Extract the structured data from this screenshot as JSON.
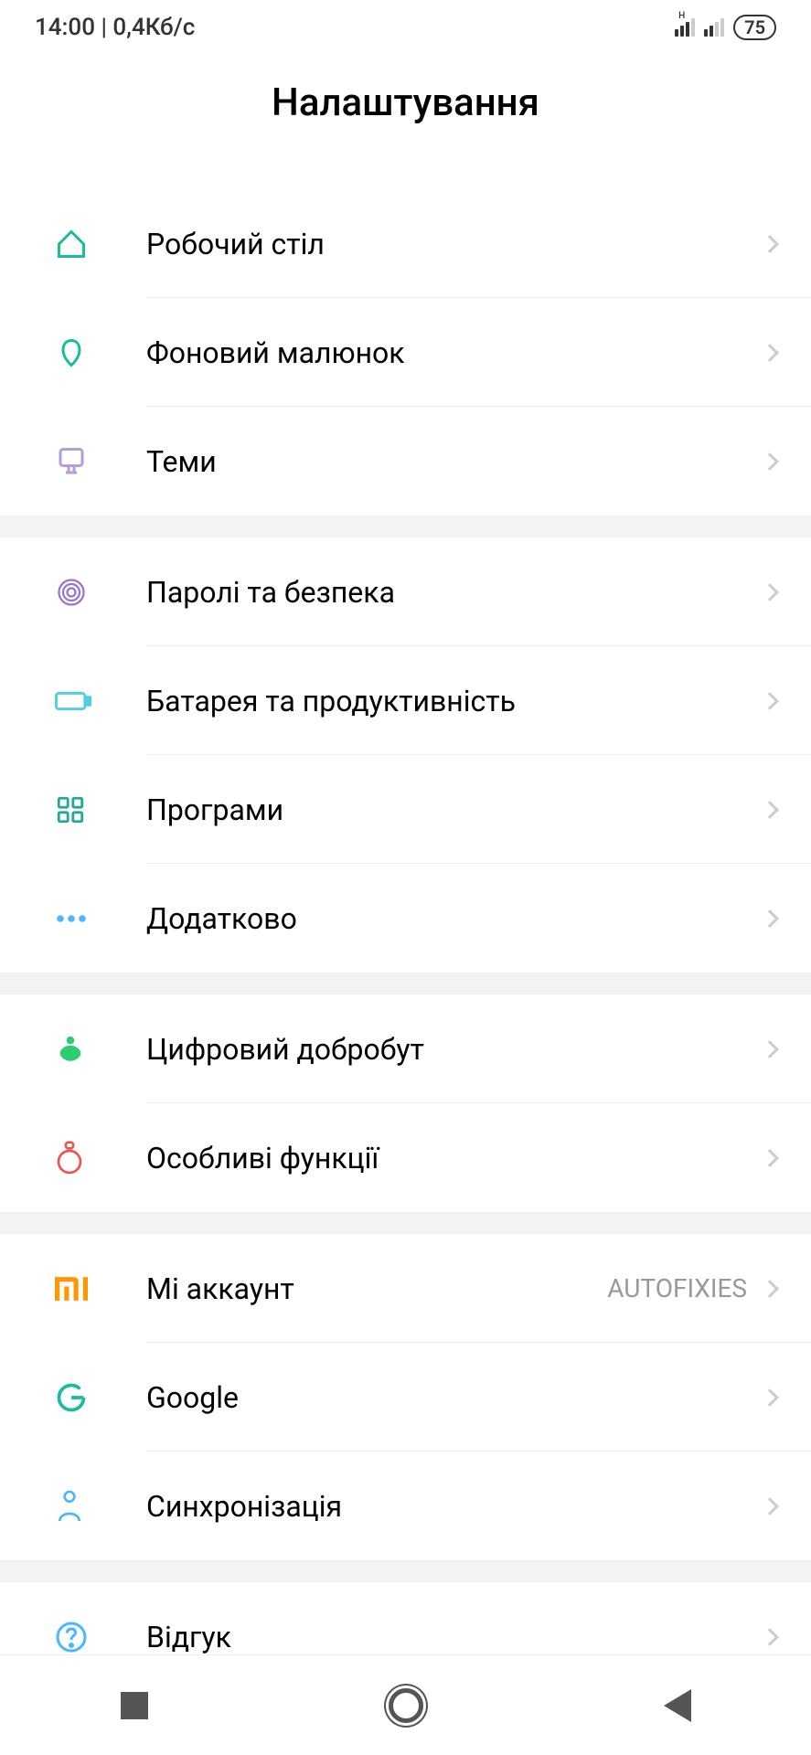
{
  "status_bar": {
    "time": "14:00",
    "speed": "0,4Кб/с",
    "battery": "75"
  },
  "header": {
    "title": "Налаштування"
  },
  "groups": [
    {
      "items": [
        {
          "id": "home",
          "label": "Робочий стіл",
          "icon": "home-icon",
          "color": "#1abc9c"
        },
        {
          "id": "wallpaper",
          "label": "Фоновий малюнок",
          "icon": "wallpaper-icon",
          "color": "#1abc9c"
        },
        {
          "id": "themes",
          "label": "Теми",
          "icon": "themes-icon",
          "color": "#b39ddb"
        }
      ]
    },
    {
      "items": [
        {
          "id": "security",
          "label": "Паролі та безпека",
          "icon": "fingerprint-icon",
          "color": "#9575cd"
        },
        {
          "id": "battery",
          "label": "Батарея та продуктивність",
          "icon": "battery-icon",
          "color": "#4dd0e1"
        },
        {
          "id": "apps",
          "label": "Програми",
          "icon": "apps-icon",
          "color": "#26a69a"
        },
        {
          "id": "additional",
          "label": "Додатково",
          "icon": "more-icon",
          "color": "#4db6ff"
        }
      ]
    },
    {
      "items": [
        {
          "id": "wellbeing",
          "label": "Цифровий добробут",
          "icon": "wellbeing-icon",
          "color": "#2ecc71"
        },
        {
          "id": "special",
          "label": "Особливі функції",
          "icon": "special-icon",
          "color": "#ef5350"
        }
      ]
    },
    {
      "items": [
        {
          "id": "mi-account",
          "label": "Мі аккаунт",
          "icon": "mi-icon",
          "color": "#ff9800",
          "value": "AUTOFIXIES"
        },
        {
          "id": "google",
          "label": "Google",
          "icon": "google-icon",
          "color": "#1abc9c"
        },
        {
          "id": "sync",
          "label": "Синхронізація",
          "icon": "sync-icon",
          "color": "#4db6ff"
        }
      ]
    },
    {
      "items": [
        {
          "id": "feedback",
          "label": "Відгук",
          "icon": "feedback-icon",
          "color": "#4db6ff"
        }
      ]
    }
  ]
}
